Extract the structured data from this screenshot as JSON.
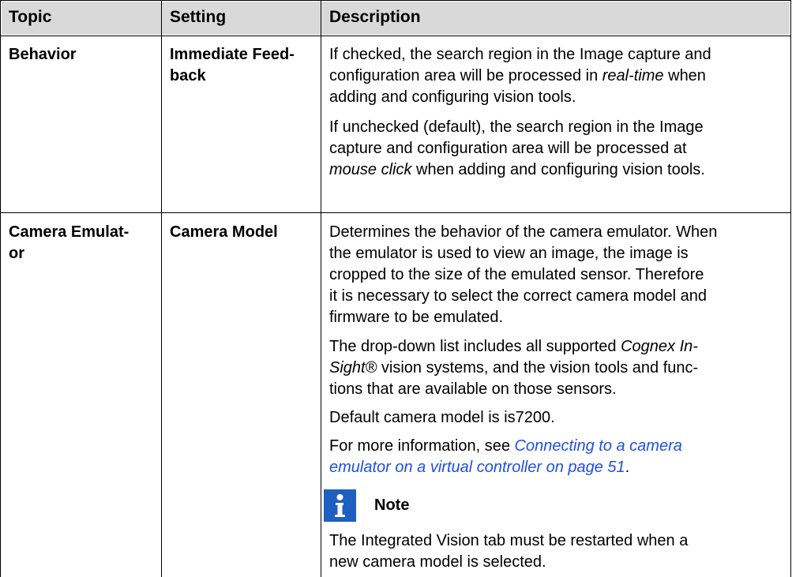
{
  "table": {
    "headers": [
      "Topic",
      "Setting",
      "Description"
    ],
    "row1": {
      "topic": "Behavior",
      "setting_line1": "Immediate Feed-",
      "setting_line2": "back",
      "p1": {
        "l1": "If checked, the search region in the Image capture and",
        "l2": "configuration area will be processed in ",
        "l2_em": "real-time",
        "l2_end": " when",
        "l3": "adding and configuring vision tools."
      },
      "p2": {
        "l1": "If unchecked (default), the search region in the Image",
        "l2": "capture and configuration area will be processed at",
        "l3_em": "mouse click",
        "l3": " when adding and configuring vision tools."
      }
    },
    "row2": {
      "topic_line1": "Camera Emulat-",
      "topic_line2": "or",
      "setting": "Camera Model",
      "p1": [
        "Determines the behavior of the camera emulator. When",
        "the emulator is used to view an image, the image is",
        "cropped to the size of the emulated sensor. Therefore",
        "it is necessary to select the correct camera model and",
        "firmware to be emulated."
      ],
      "p2": {
        "l1": "The drop-down list includes all supported ",
        "l1_em": "Cognex In-",
        "l2_em": "Sight®",
        "l2": " vision systems, and the vision tools and func-",
        "l3": "tions that are available on those sensors."
      },
      "p3": "Default camera model is is7200.",
      "p4": {
        "pre": "For more information, see ",
        "link1": "Connecting to a camera",
        "link2": "emulator on a virtual controller on page 51",
        "post": "."
      },
      "note_label": "Note",
      "note_l1": "The Integrated Vision tab must be restarted when a",
      "note_l2": "new camera model is selected."
    }
  },
  "icons": {
    "note": "info-icon"
  }
}
